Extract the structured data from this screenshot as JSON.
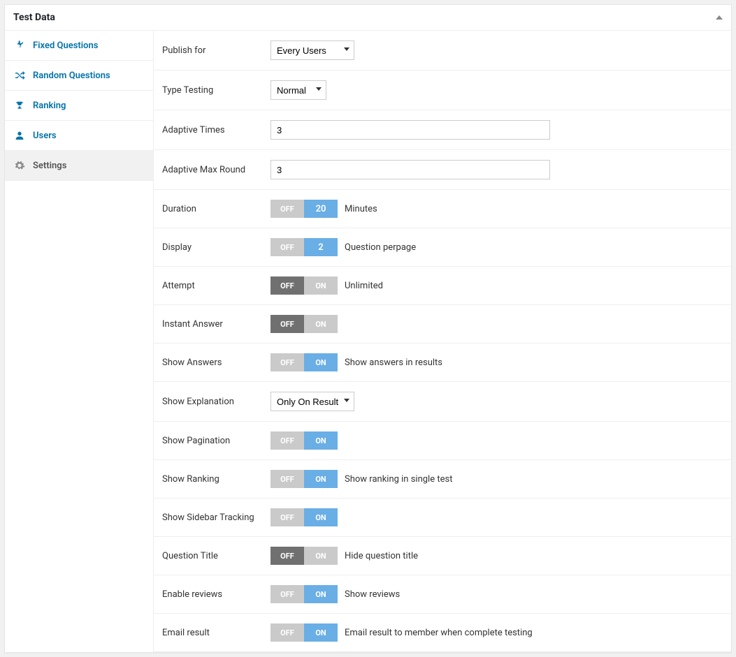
{
  "panel_title": "Test Data",
  "sidebar": {
    "items": [
      {
        "label": "Fixed Questions",
        "icon": "pin"
      },
      {
        "label": "Random Questions",
        "icon": "shuffle"
      },
      {
        "label": "Ranking",
        "icon": "trophy"
      },
      {
        "label": "Users",
        "icon": "user"
      },
      {
        "label": "Settings",
        "icon": "gear",
        "active": true
      }
    ]
  },
  "fields": {
    "publish_for": {
      "label": "Publish for",
      "value": "Every Users"
    },
    "type_testing": {
      "label": "Type Testing",
      "value": "Normal"
    },
    "adaptive_times": {
      "label": "Adaptive Times",
      "value": "3"
    },
    "adaptive_max_round": {
      "label": "Adaptive Max Round",
      "value": "3"
    },
    "duration": {
      "label": "Duration",
      "off": "OFF",
      "value": "20",
      "hint": "Minutes"
    },
    "display": {
      "label": "Display",
      "off": "OFF",
      "value": "2",
      "hint": "Question perpage"
    },
    "attempt": {
      "label": "Attempt",
      "off": "OFF",
      "on": "ON",
      "hint": "Unlimited",
      "state": "off"
    },
    "instant_answer": {
      "label": "Instant Answer",
      "off": "OFF",
      "on": "ON",
      "state": "off"
    },
    "show_answers": {
      "label": "Show Answers",
      "off": "OFF",
      "on": "ON",
      "hint": "Show answers in results",
      "state": "on"
    },
    "show_explanation": {
      "label": "Show Explanation",
      "value": "Only On Result"
    },
    "show_pagination": {
      "label": "Show Pagination",
      "off": "OFF",
      "on": "ON",
      "state": "on"
    },
    "show_ranking": {
      "label": "Show Ranking",
      "off": "OFF",
      "on": "ON",
      "hint": "Show ranking in single test",
      "state": "on"
    },
    "show_sidebar_tracking": {
      "label": "Show Sidebar Tracking",
      "off": "OFF",
      "on": "ON",
      "state": "on"
    },
    "question_title": {
      "label": "Question Title",
      "off": "OFF",
      "on": "ON",
      "hint": "Hide question title",
      "state": "off"
    },
    "enable_reviews": {
      "label": "Enable reviews",
      "off": "OFF",
      "on": "ON",
      "hint": "Show reviews",
      "state": "on"
    },
    "email_result": {
      "label": "Email result",
      "off": "OFF",
      "on": "ON",
      "hint": "Email result to member when complete testing",
      "state": "on"
    }
  }
}
